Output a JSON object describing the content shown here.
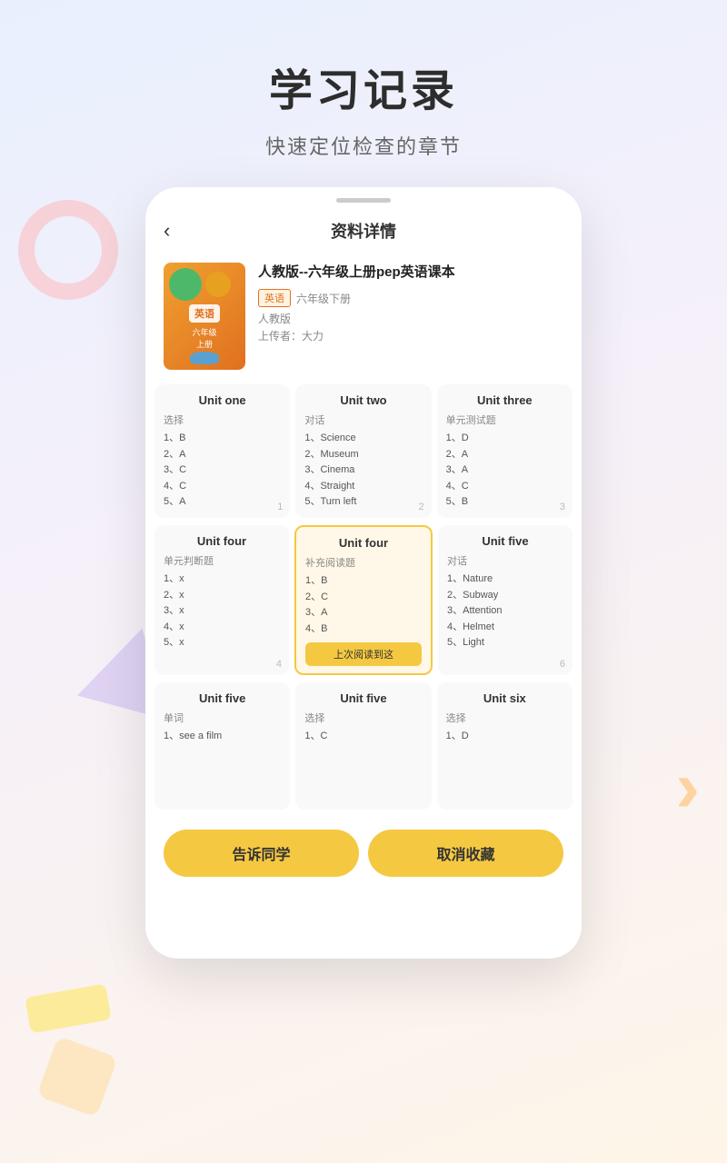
{
  "page": {
    "background_title": "学习记录",
    "background_subtitle": "快速定位检查的章节"
  },
  "app": {
    "back_icon": "‹",
    "header_title": "资料详情",
    "book": {
      "title": "人教版--六年级上册pep英语课本",
      "tag_subject": "英语",
      "tag_grade": "六年级下册",
      "publisher": "人教版",
      "uploader": "上传者：大力"
    },
    "units_row1": [
      {
        "title": "Unit one",
        "subtitle": "选择",
        "items": [
          "1、B",
          "2、A",
          "3、C",
          "4、C",
          "5、A"
        ],
        "page": "1"
      },
      {
        "title": "Unit two",
        "subtitle": "对话",
        "items": [
          "1、Science",
          "2、Museum",
          "3、Cinema",
          "4、Straight",
          "5、Turn left"
        ],
        "page": "2"
      },
      {
        "title": "Unit three",
        "subtitle": "单元测试题",
        "items": [
          "1、D",
          "2、A",
          "3、A",
          "4、C",
          "5、B"
        ],
        "page": "3"
      }
    ],
    "units_row2": [
      {
        "title": "Unit four",
        "subtitle": "单元判断题",
        "items": [
          "1、x",
          "2、x",
          "3、x",
          "4、x",
          "5、x"
        ],
        "page": "4",
        "highlighted": false
      },
      {
        "title": "Unit four",
        "subtitle": "补充阅读题",
        "items": [
          "1、B",
          "2、C",
          "3、A",
          "4、B"
        ],
        "page": "",
        "highlighted": true,
        "last_read": "上次阅读到这"
      },
      {
        "title": "Unit five",
        "subtitle": "对话",
        "items": [
          "1、Nature",
          "2、Subway",
          "3、Attention",
          "4、Helmet",
          "5、Light"
        ],
        "page": "6",
        "highlighted": false
      }
    ],
    "units_row3": [
      {
        "title": "Unit five",
        "subtitle": "单词",
        "items": [
          "1、see a film"
        ],
        "page": ""
      },
      {
        "title": "Unit five",
        "subtitle": "选择",
        "items": [
          "1、C"
        ],
        "page": ""
      },
      {
        "title": "Unit six",
        "subtitle": "选择",
        "items": [
          "1、D"
        ],
        "page": ""
      }
    ],
    "buttons": {
      "tell": "告诉同学",
      "uncollect": "取消收藏"
    }
  }
}
